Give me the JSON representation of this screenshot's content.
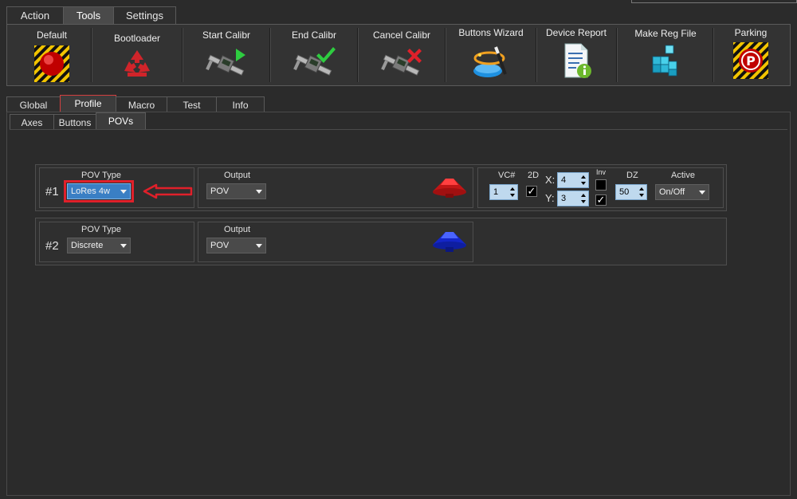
{
  "top_tabs": [
    "Action",
    "Tools",
    "Settings"
  ],
  "toolbar": [
    {
      "label": "Default",
      "icon": "red-button-icon"
    },
    {
      "label": "Bootloader",
      "icon": "recycle-icon"
    },
    {
      "label": "Start Calibr",
      "icon": "caliper-play-icon"
    },
    {
      "label": "End Calibr",
      "icon": "caliper-check-icon"
    },
    {
      "label": "Cancel Calibr",
      "icon": "caliper-cancel-icon"
    },
    {
      "label": "Buttons Wizard",
      "icon": "wizard-icon"
    },
    {
      "label": "Device Report",
      "icon": "report-icon"
    },
    {
      "label": "Make Reg File",
      "icon": "registry-icon"
    },
    {
      "label": "Parking",
      "icon": "parking-icon"
    }
  ],
  "profile_tabs": [
    "Global",
    "Profile",
    "Macro",
    "Test",
    "Info"
  ],
  "sub_tabs": [
    "Axes",
    "Buttons",
    "POVs"
  ],
  "povs": [
    {
      "number": "#1",
      "type_label": "POV Type",
      "type_value": "LoRes 4w",
      "output_label": "Output",
      "output_value": "POV",
      "color": "#d01818"
    },
    {
      "number": "#2",
      "type_label": "POV Type",
      "type_value": "Discrete",
      "output_label": "Output",
      "output_value": "POV",
      "color": "#1a32d8"
    }
  ],
  "pov1_extra": {
    "vc_label": "VC#",
    "vc_value": "1",
    "d2_label": "2D",
    "d2_checked": "✓",
    "x_label": "X:",
    "x_value": "4",
    "y_label": "Y:",
    "y_value": "3",
    "inv_label": "Inv",
    "inv_y_checked": "✓",
    "dz_label": "DZ",
    "dz_value": "50",
    "active_label": "Active",
    "active_value": "On/Off"
  }
}
